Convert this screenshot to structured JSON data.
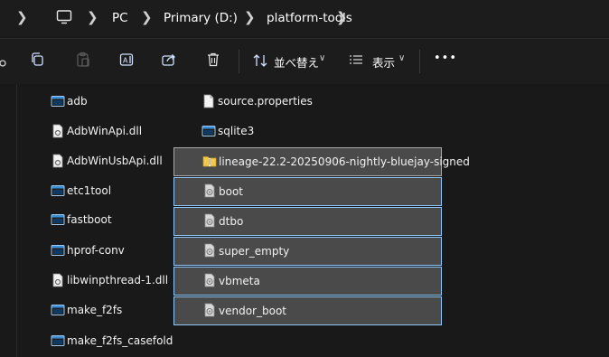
{
  "breadcrumb": {
    "items": [
      "PC",
      "Primary (D:)",
      "platform-tools"
    ]
  },
  "toolbar": {
    "sort_label": "並べ替え",
    "view_label": "表示",
    "more_label": "•••"
  },
  "files_col1": [
    {
      "name": "adb",
      "icon": "exe-icon"
    },
    {
      "name": "AdbWinApi.dll",
      "icon": "dll-icon"
    },
    {
      "name": "AdbWinUsbApi.dll",
      "icon": "dll-icon"
    },
    {
      "name": "etc1tool",
      "icon": "exe-icon"
    },
    {
      "name": "fastboot",
      "icon": "exe-icon"
    },
    {
      "name": "hprof-conv",
      "icon": "exe-icon"
    },
    {
      "name": "libwinpthread-1.dll",
      "icon": "dll-icon"
    },
    {
      "name": "make_f2fs",
      "icon": "exe-icon"
    },
    {
      "name": "make_f2fs_casefold",
      "icon": "exe-icon"
    }
  ],
  "files_col2": [
    {
      "name": "source.properties",
      "icon": "file-icon",
      "selected": false
    },
    {
      "name": "sqlite3",
      "icon": "exe-icon",
      "selected": false
    },
    {
      "name": "lineage-22.2-20250906-nightly-bluejay-signed",
      "icon": "zip-folder-icon",
      "selected": true
    },
    {
      "name": "boot",
      "icon": "img-file-icon",
      "selected": true
    },
    {
      "name": "dtbo",
      "icon": "img-file-icon",
      "selected": true
    },
    {
      "name": "super_empty",
      "icon": "img-file-icon",
      "selected": true
    },
    {
      "name": "vbmeta",
      "icon": "img-file-icon",
      "selected": true
    },
    {
      "name": "vendor_boot",
      "icon": "img-file-icon",
      "selected": true
    }
  ],
  "colors": {
    "background": "#191919",
    "selection_fill": "#4a4a4a",
    "selection_border": "#8fc8ff"
  }
}
